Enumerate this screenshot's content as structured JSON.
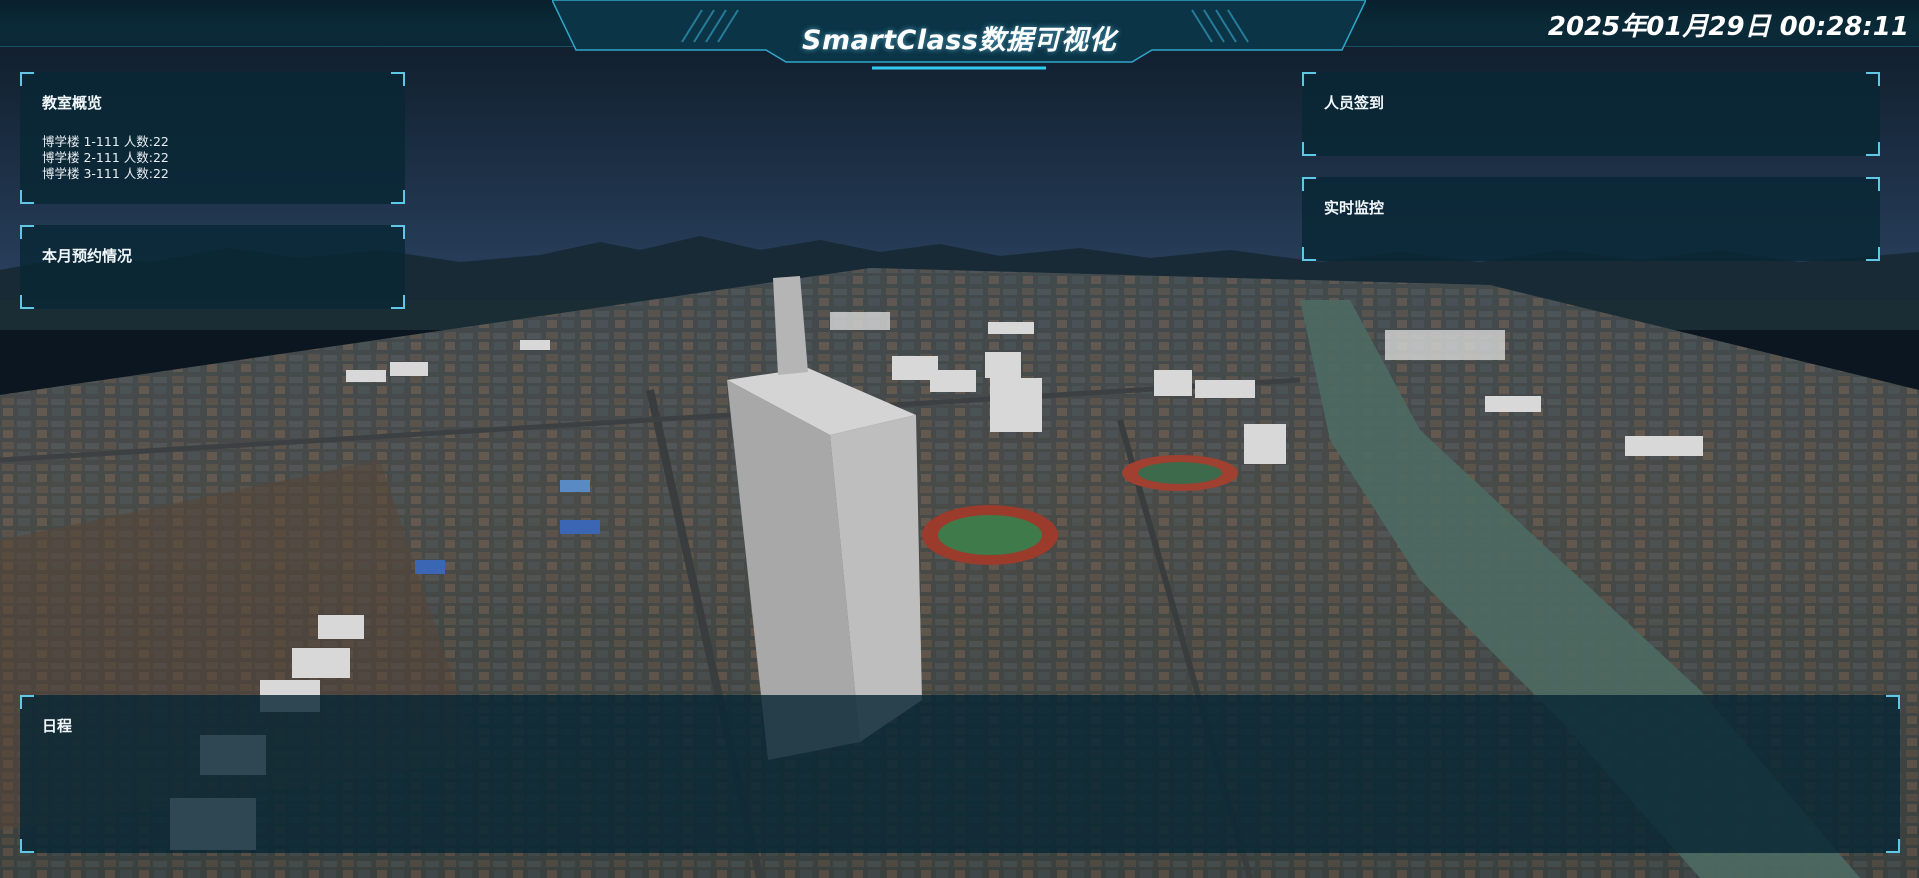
{
  "header": {
    "title": "SmartClass数据可视化",
    "datetime": "2025年01月29日 00:28:11"
  },
  "panels": {
    "overview": {
      "title": "教室概览",
      "rows": [
        "博学楼 1-111 人数:22",
        "博学楼 2-111 人数:22",
        "博学楼 3-111 人数:22"
      ]
    },
    "booking": {
      "title": "本月预约情况"
    },
    "checkin": {
      "title": "人员签到"
    },
    "monitor": {
      "title": "实时监控"
    },
    "schedule": {
      "title": "日程"
    }
  },
  "colors": {
    "accent": "#5ec8e6",
    "panel_bg": "#092734",
    "header_bg": "#0a2a38"
  }
}
